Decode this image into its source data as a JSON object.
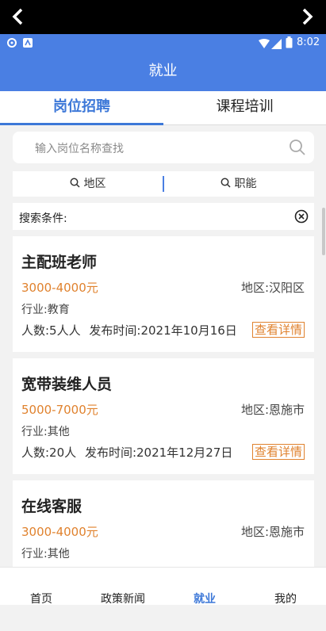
{
  "status_bar": {
    "time": "8:02"
  },
  "app_bar": {
    "title": "就业"
  },
  "tabs": [
    {
      "label": "岗位招聘",
      "active": true
    },
    {
      "label": "课程培训",
      "active": false
    }
  ],
  "search": {
    "placeholder": "输入岗位名称查找"
  },
  "filters": {
    "region_label": "地区",
    "function_label": "职能"
  },
  "conditions": {
    "label": "搜索条件:"
  },
  "jobs": [
    {
      "title": "主配班老师",
      "salary": "3000-4000元",
      "region": "地区:汉阳区",
      "industry": "行业:教育",
      "headcount": "人数:5人人",
      "posted": "发布时间:2021年10月16日",
      "detail_label": "查看详情"
    },
    {
      "title": "宽带装维人员",
      "salary": "5000-7000元",
      "region": "地区:恩施市",
      "industry": "行业:其他",
      "headcount": "人数:20人",
      "posted": "发布时间:2021年12月27日",
      "detail_label": "查看详情"
    },
    {
      "title": "在线客服",
      "salary": "3000-4000元",
      "region": "地区:恩施市",
      "industry": "行业:其他"
    }
  ],
  "bottom_nav": [
    {
      "label": "首页",
      "active": false
    },
    {
      "label": "政策新闻",
      "active": false
    },
    {
      "label": "就业",
      "active": true
    },
    {
      "label": "我的",
      "active": false
    }
  ],
  "colors": {
    "primary": "#4a7fe3",
    "accent": "#e0822e"
  }
}
